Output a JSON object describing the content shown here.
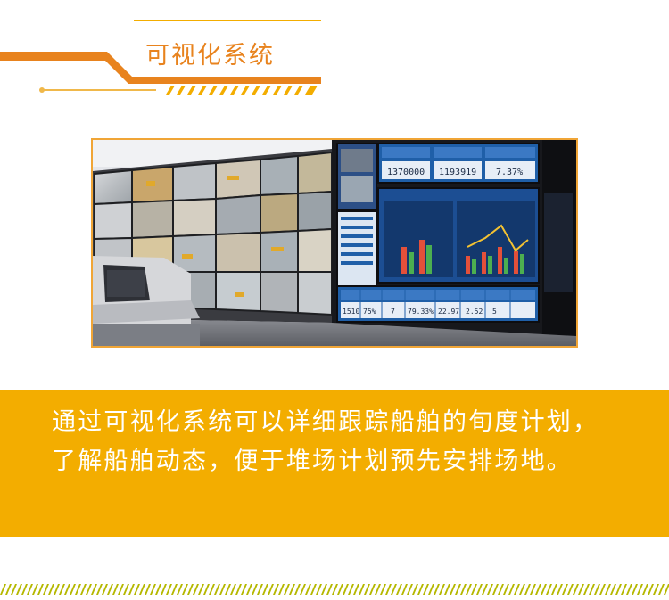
{
  "section": {
    "title": "可视化系统"
  },
  "photo": {
    "kpi_values": [
      "1370000",
      "1193919",
      "7.37%"
    ],
    "table_values": [
      "1510",
      "75%",
      "7",
      "79.33%",
      "22.97",
      "2.52",
      "5"
    ]
  },
  "caption": {
    "text": "通过可视化系统可以详细跟踪船舶的旬度计划，了解船舶动态，便于堆场计划预先安排场地。"
  },
  "colors": {
    "orange": "#e8831e",
    "yellow": "#f3ad00",
    "olive": "#b5b800",
    "frame": "#f0a536"
  }
}
